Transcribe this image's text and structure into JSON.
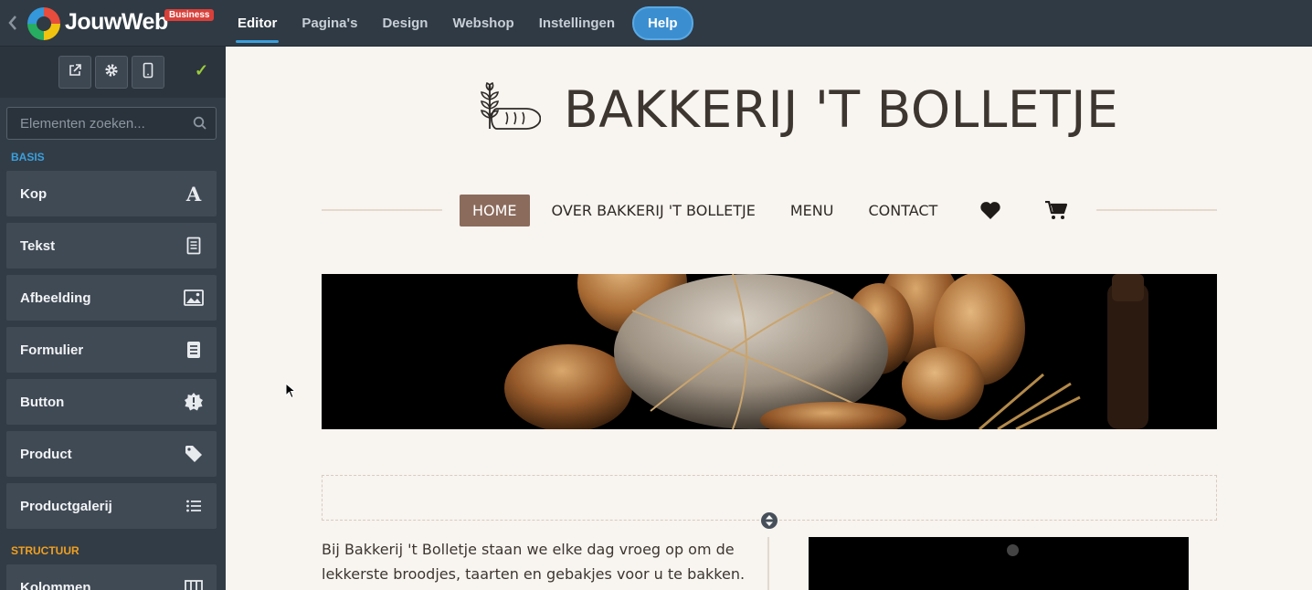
{
  "topbar": {
    "brand": "JouwWeb",
    "badge": "Business",
    "nav": [
      {
        "label": "Editor",
        "active": true
      },
      {
        "label": "Pagina's",
        "active": false
      },
      {
        "label": "Design",
        "active": false
      },
      {
        "label": "Webshop",
        "active": false
      },
      {
        "label": "Instellingen",
        "active": false
      }
    ],
    "help": "Help"
  },
  "sidebar": {
    "tools": [
      "external-link-icon",
      "gear-icon",
      "mobile-icon"
    ],
    "confirm": "✓",
    "search_placeholder": "Elementen zoeken...",
    "section_basis": "BASIS",
    "section_basis_color": "#3aa0de",
    "section_structuur": "STRUCTUUR",
    "section_structuur_color": "#f0a020",
    "elements": [
      {
        "label": "Kop",
        "icon": "heading-icon"
      },
      {
        "label": "Tekst",
        "icon": "text-icon"
      },
      {
        "label": "Afbeelding",
        "icon": "image-icon"
      },
      {
        "label": "Formulier",
        "icon": "form-icon"
      },
      {
        "label": "Button",
        "icon": "button-icon"
      },
      {
        "label": "Product",
        "icon": "tag-icon"
      },
      {
        "label": "Productgalerij",
        "icon": "list-icon"
      }
    ],
    "structure_elements": [
      {
        "label": "Kolommen",
        "icon": "columns-icon"
      }
    ]
  },
  "site": {
    "title": "BAKKERIJ 'T BOLLETJE",
    "menu": [
      {
        "label": "HOME",
        "active": true
      },
      {
        "label": "OVER BAKKERIJ 'T BOLLETJE",
        "active": false
      },
      {
        "label": "MENU",
        "active": false
      },
      {
        "label": "CONTACT",
        "active": false
      }
    ],
    "menu_icons": [
      "heart-icon",
      "cart-icon"
    ],
    "accent": "#8b6b5c",
    "body_text": "Bij Bakkerij 't Bolletje staan we elke dag vroeg op om de lekkerste broodjes, taarten en gebakjes voor u te bakken."
  }
}
